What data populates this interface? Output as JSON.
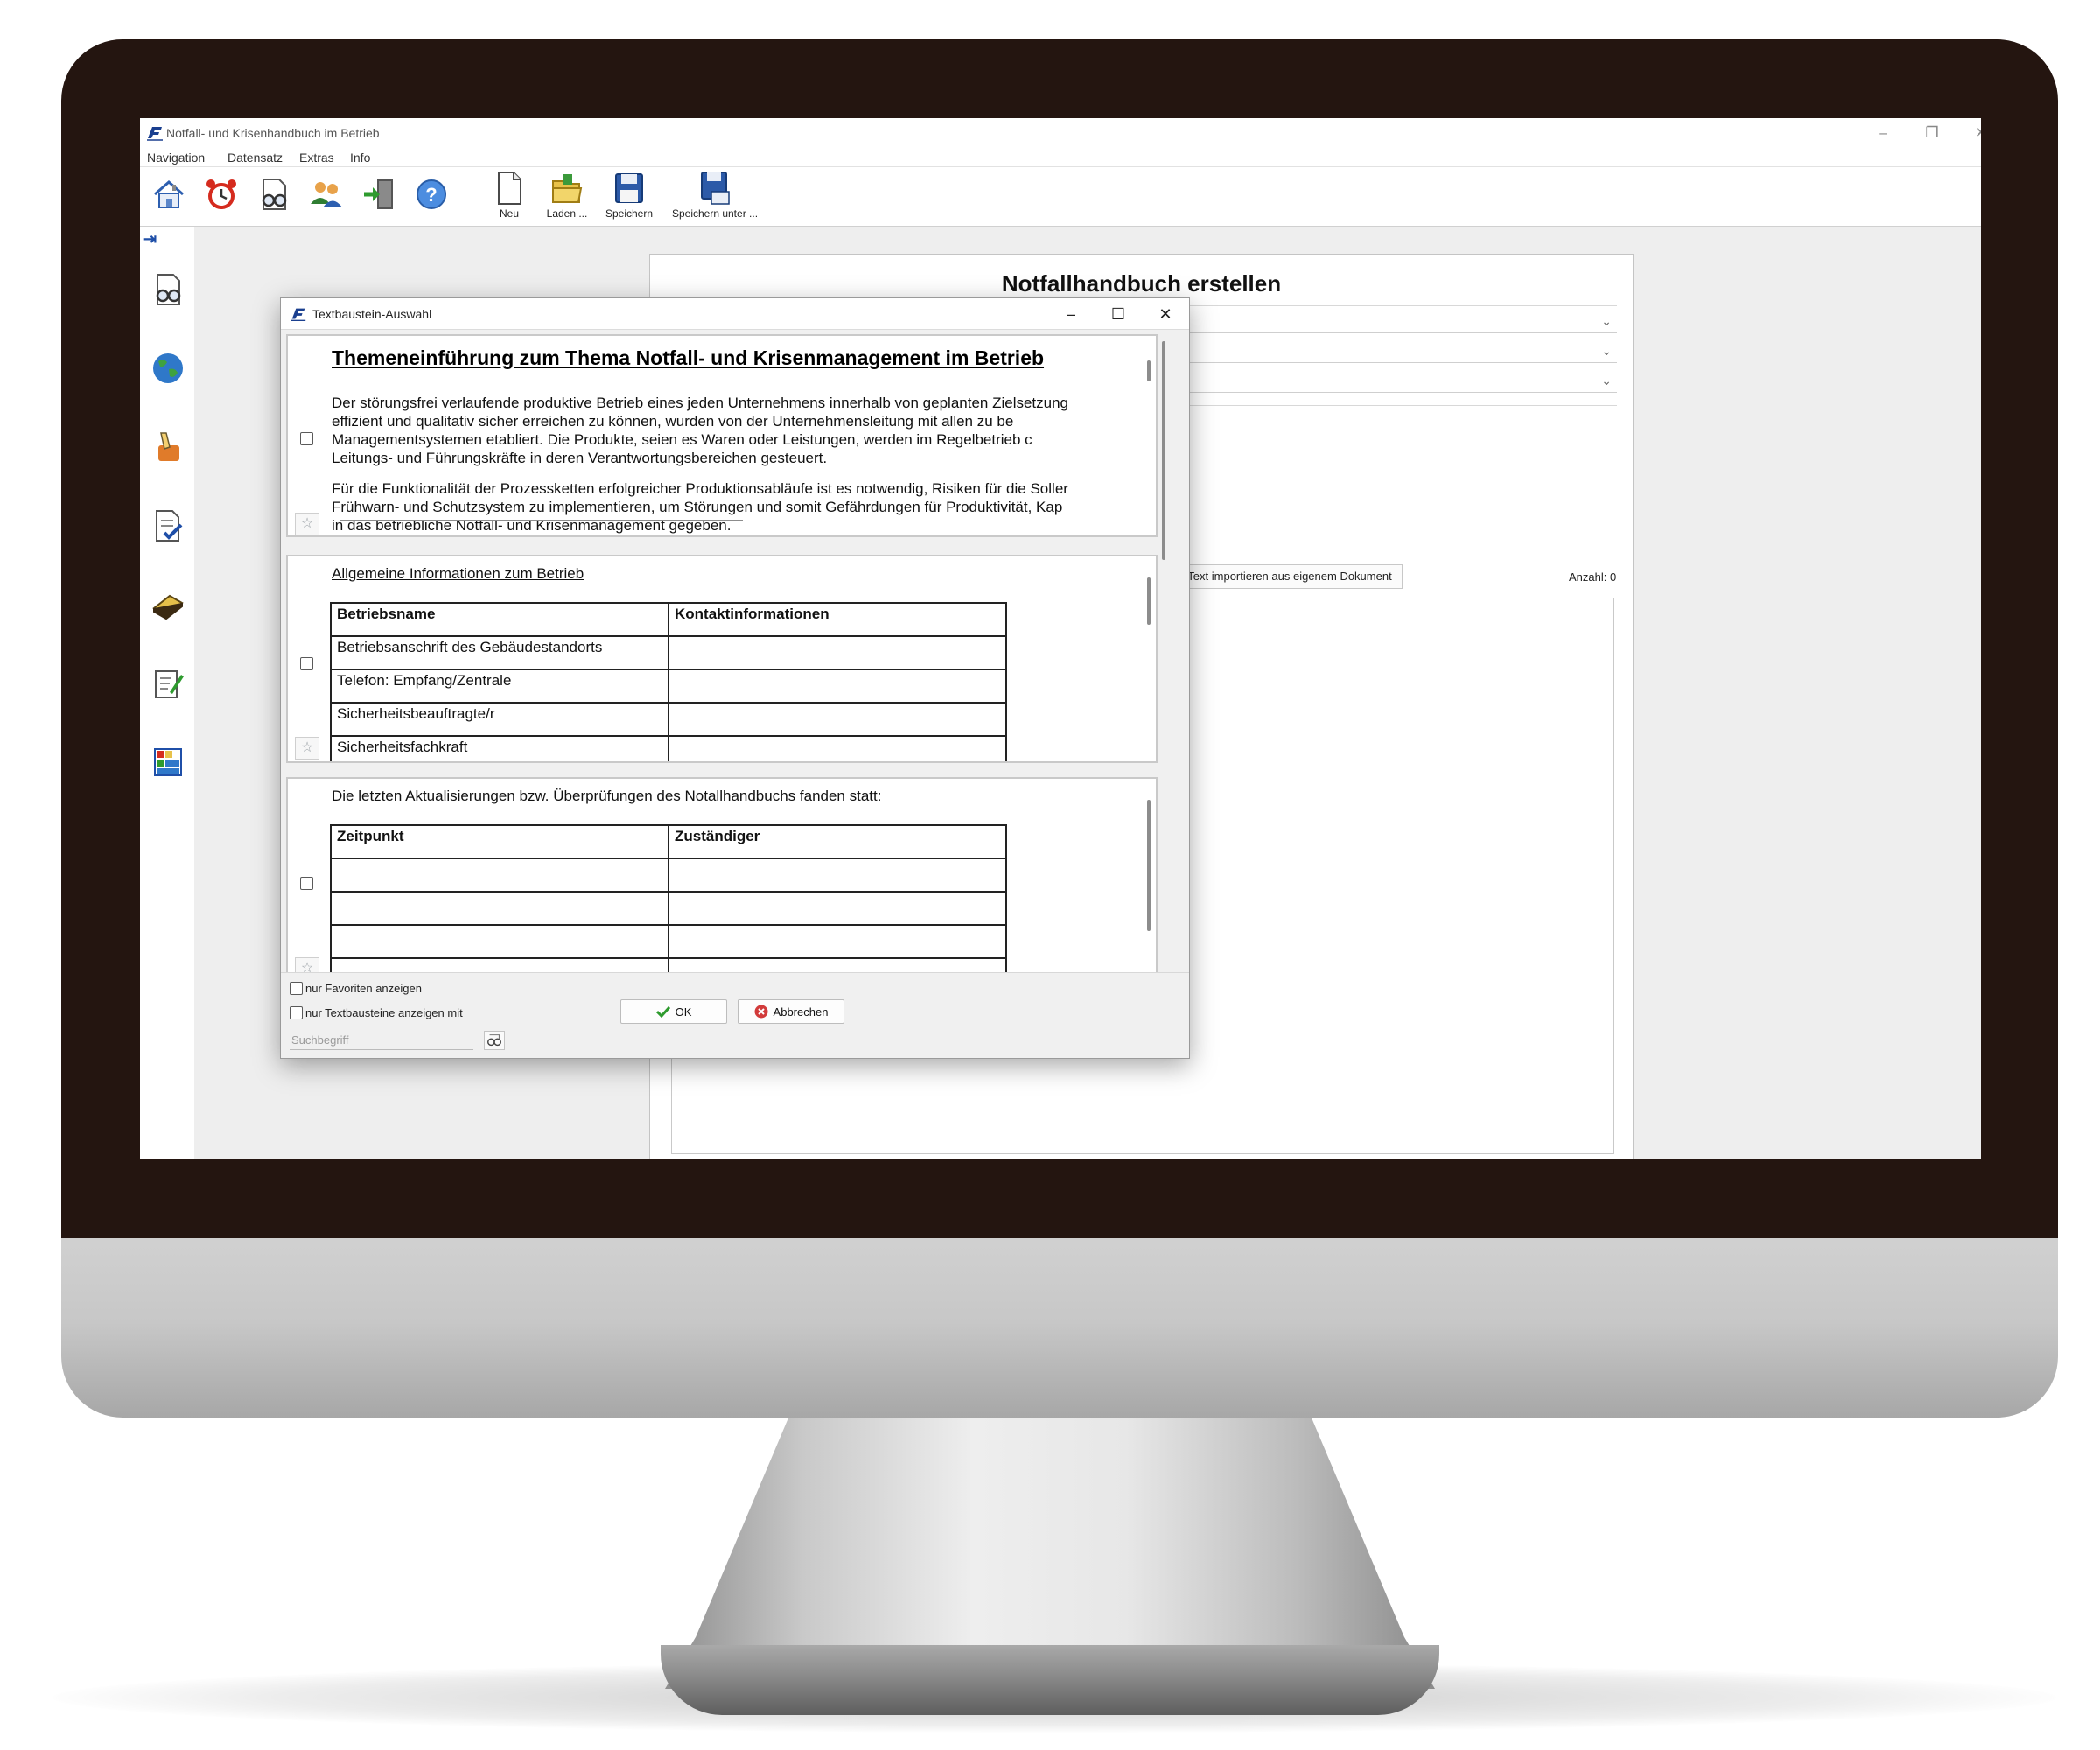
{
  "app": {
    "title": "Notfall- und Krisenhandbuch im Betrieb",
    "window_controls": [
      "–",
      "❐",
      "✕"
    ]
  },
  "menu": [
    "Navigation",
    "Datensatz",
    "Extras",
    "Info"
  ],
  "toolbar": {
    "icons": [
      "home-icon",
      "alarm-clock-icon",
      "document-glasses-icon",
      "users-icon",
      "exit-icon",
      "help-icon"
    ],
    "file_buttons": [
      {
        "label": "Neu",
        "icon": "new-document-icon"
      },
      {
        "label": "Laden ...",
        "icon": "open-folder-icon"
      },
      {
        "label": "Speichern",
        "icon": "save-icon"
      },
      {
        "label": "Speichern unter ...",
        "icon": "save-as-icon"
      }
    ]
  },
  "sidebar": {
    "expand_glyph": "⇥",
    "icons": [
      "document-glasses-icon",
      "globe-icon",
      "pencil-edit-icon",
      "checklist-icon",
      "handbook-icon",
      "note-edit-icon",
      "table-icon"
    ]
  },
  "main_form": {
    "title": "Notfallhandbuch erstellen",
    "import_button": "Text importieren aus eigenem Dokument",
    "count_label": "Anzahl: 0"
  },
  "dialog": {
    "title": "Textbaustein-Auswahl",
    "window_controls": [
      "–",
      "☐",
      "✕"
    ],
    "cards": [
      {
        "heading": "Themeneinführung zum Thema Notfall- und Krisenmanagement im Betrieb",
        "paragraph1": [
          "Der störungsfrei verlaufende produktive Betrieb eines jeden Unternehmens innerhalb von geplanten Zielsetzung",
          "effizient und qualitativ sicher erreichen zu können, wurden von der Unternehmensleitung mit allen zu be",
          "Managementsystemen etabliert. Die Produkte, seien es Waren oder Leistungen, werden im Regelbetrieb c",
          "Leitungs- und Führungskräfte in deren Verantwortungsbereichen gesteuert."
        ],
        "paragraph2": [
          "Für die Funktionalität der Prozessketten erfolgreicher Produktionsabläufe ist es notwendig, Risiken für die Soller",
          "Frühwarn- und Schutzsystem zu implementieren, um Störungen und somit Gefährdungen für Produktivität, Kap",
          "in das betriebliche Notfall- und Krisenmanagement gegeben."
        ]
      },
      {
        "subheading": "Allgemeine Informationen zum Betrieb",
        "columns": [
          "Betriebsname",
          "Kontaktinformationen"
        ],
        "rows": [
          [
            "Betriebsanschrift des Gebäudestandorts",
            ""
          ],
          [
            "Telefon: Empfang/Zentrale",
            ""
          ],
          [
            "Sicherheitsbeauftragte/r",
            ""
          ],
          [
            "Sicherheitsfachkraft",
            ""
          ]
        ]
      },
      {
        "subheading": "Die letzten Aktualisierungen bzw. Überprüfungen des Notallhandbuchs fanden statt:",
        "columns": [
          "Zeitpunkt",
          "Zuständiger"
        ],
        "rows": [
          [
            "",
            ""
          ],
          [
            "",
            ""
          ],
          [
            "",
            ""
          ],
          [
            "",
            ""
          ]
        ]
      }
    ],
    "star_glyph": "☆",
    "filters": {
      "favorites_only": "nur Favoriten anzeigen",
      "text_blocks_with": "nur Textbausteine anzeigen mit",
      "search_placeholder": "Suchbegriff"
    },
    "buttons": {
      "ok": "OK",
      "cancel": "Abbrechen"
    }
  },
  "colors": {
    "bezel": "#241510",
    "accent_blue": "#1f4fa8",
    "ok_green": "#2e9b2e",
    "cancel_red": "#d23b3b"
  }
}
